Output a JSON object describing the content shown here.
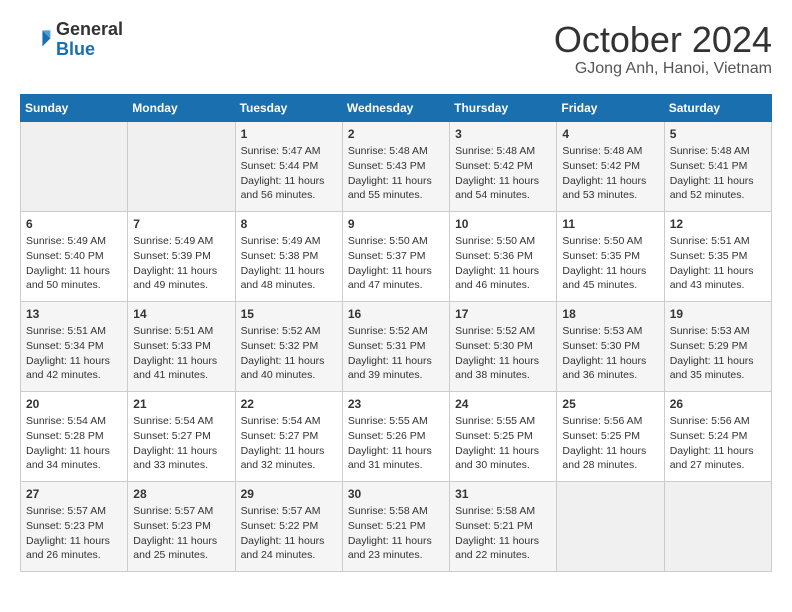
{
  "logo": {
    "line1": "General",
    "line2": "Blue"
  },
  "title": "October 2024",
  "location": "GJong Anh, Hanoi, Vietnam",
  "headers": [
    "Sunday",
    "Monday",
    "Tuesday",
    "Wednesday",
    "Thursday",
    "Friday",
    "Saturday"
  ],
  "weeks": [
    [
      {
        "day": "",
        "info": ""
      },
      {
        "day": "",
        "info": ""
      },
      {
        "day": "1",
        "info": "Sunrise: 5:47 AM\nSunset: 5:44 PM\nDaylight: 11 hours and 56 minutes."
      },
      {
        "day": "2",
        "info": "Sunrise: 5:48 AM\nSunset: 5:43 PM\nDaylight: 11 hours and 55 minutes."
      },
      {
        "day": "3",
        "info": "Sunrise: 5:48 AM\nSunset: 5:42 PM\nDaylight: 11 hours and 54 minutes."
      },
      {
        "day": "4",
        "info": "Sunrise: 5:48 AM\nSunset: 5:42 PM\nDaylight: 11 hours and 53 minutes."
      },
      {
        "day": "5",
        "info": "Sunrise: 5:48 AM\nSunset: 5:41 PM\nDaylight: 11 hours and 52 minutes."
      }
    ],
    [
      {
        "day": "6",
        "info": "Sunrise: 5:49 AM\nSunset: 5:40 PM\nDaylight: 11 hours and 50 minutes."
      },
      {
        "day": "7",
        "info": "Sunrise: 5:49 AM\nSunset: 5:39 PM\nDaylight: 11 hours and 49 minutes."
      },
      {
        "day": "8",
        "info": "Sunrise: 5:49 AM\nSunset: 5:38 PM\nDaylight: 11 hours and 48 minutes."
      },
      {
        "day": "9",
        "info": "Sunrise: 5:50 AM\nSunset: 5:37 PM\nDaylight: 11 hours and 47 minutes."
      },
      {
        "day": "10",
        "info": "Sunrise: 5:50 AM\nSunset: 5:36 PM\nDaylight: 11 hours and 46 minutes."
      },
      {
        "day": "11",
        "info": "Sunrise: 5:50 AM\nSunset: 5:35 PM\nDaylight: 11 hours and 45 minutes."
      },
      {
        "day": "12",
        "info": "Sunrise: 5:51 AM\nSunset: 5:35 PM\nDaylight: 11 hours and 43 minutes."
      }
    ],
    [
      {
        "day": "13",
        "info": "Sunrise: 5:51 AM\nSunset: 5:34 PM\nDaylight: 11 hours and 42 minutes."
      },
      {
        "day": "14",
        "info": "Sunrise: 5:51 AM\nSunset: 5:33 PM\nDaylight: 11 hours and 41 minutes."
      },
      {
        "day": "15",
        "info": "Sunrise: 5:52 AM\nSunset: 5:32 PM\nDaylight: 11 hours and 40 minutes."
      },
      {
        "day": "16",
        "info": "Sunrise: 5:52 AM\nSunset: 5:31 PM\nDaylight: 11 hours and 39 minutes."
      },
      {
        "day": "17",
        "info": "Sunrise: 5:52 AM\nSunset: 5:30 PM\nDaylight: 11 hours and 38 minutes."
      },
      {
        "day": "18",
        "info": "Sunrise: 5:53 AM\nSunset: 5:30 PM\nDaylight: 11 hours and 36 minutes."
      },
      {
        "day": "19",
        "info": "Sunrise: 5:53 AM\nSunset: 5:29 PM\nDaylight: 11 hours and 35 minutes."
      }
    ],
    [
      {
        "day": "20",
        "info": "Sunrise: 5:54 AM\nSunset: 5:28 PM\nDaylight: 11 hours and 34 minutes."
      },
      {
        "day": "21",
        "info": "Sunrise: 5:54 AM\nSunset: 5:27 PM\nDaylight: 11 hours and 33 minutes."
      },
      {
        "day": "22",
        "info": "Sunrise: 5:54 AM\nSunset: 5:27 PM\nDaylight: 11 hours and 32 minutes."
      },
      {
        "day": "23",
        "info": "Sunrise: 5:55 AM\nSunset: 5:26 PM\nDaylight: 11 hours and 31 minutes."
      },
      {
        "day": "24",
        "info": "Sunrise: 5:55 AM\nSunset: 5:25 PM\nDaylight: 11 hours and 30 minutes."
      },
      {
        "day": "25",
        "info": "Sunrise: 5:56 AM\nSunset: 5:25 PM\nDaylight: 11 hours and 28 minutes."
      },
      {
        "day": "26",
        "info": "Sunrise: 5:56 AM\nSunset: 5:24 PM\nDaylight: 11 hours and 27 minutes."
      }
    ],
    [
      {
        "day": "27",
        "info": "Sunrise: 5:57 AM\nSunset: 5:23 PM\nDaylight: 11 hours and 26 minutes."
      },
      {
        "day": "28",
        "info": "Sunrise: 5:57 AM\nSunset: 5:23 PM\nDaylight: 11 hours and 25 minutes."
      },
      {
        "day": "29",
        "info": "Sunrise: 5:57 AM\nSunset: 5:22 PM\nDaylight: 11 hours and 24 minutes."
      },
      {
        "day": "30",
        "info": "Sunrise: 5:58 AM\nSunset: 5:21 PM\nDaylight: 11 hours and 23 minutes."
      },
      {
        "day": "31",
        "info": "Sunrise: 5:58 AM\nSunset: 5:21 PM\nDaylight: 11 hours and 22 minutes."
      },
      {
        "day": "",
        "info": ""
      },
      {
        "day": "",
        "info": ""
      }
    ]
  ]
}
